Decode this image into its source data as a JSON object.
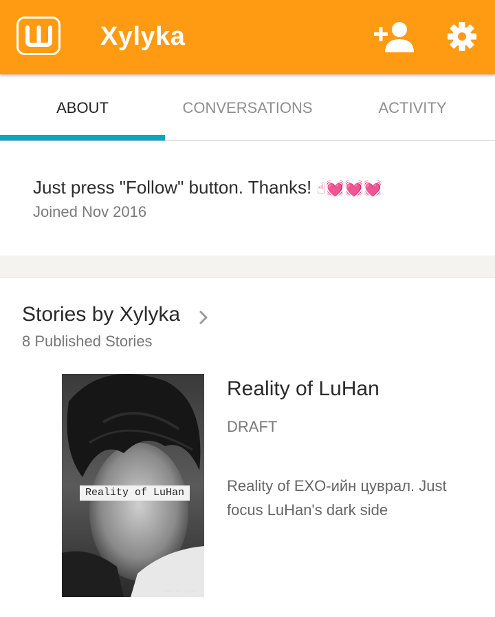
{
  "appbar": {
    "logo_letter": "W",
    "title": "Xylyka",
    "brand_color": "#ff9b13",
    "icons": [
      "add-user-icon",
      "gear-icon"
    ]
  },
  "tabs": [
    {
      "label": "ABOUT",
      "active": true
    },
    {
      "label": "CONVERSATIONS",
      "active": false
    },
    {
      "label": "ACTIVITY",
      "active": false
    }
  ],
  "tab_indicator_color": "#0aa6bd",
  "about": {
    "text": "Just press \"Follow\" button. Thanks!",
    "emoji": "☝💓💓💓",
    "joined": "Joined Nov 2016"
  },
  "stories": {
    "header": "Stories by Xylyka",
    "count_label": "8 Published Stories",
    "items": [
      {
        "title": "Reality of LuHan",
        "status": "DRAFT",
        "description": "Reality of EXO-ийн цуврал. Just focus LuHan's dark side",
        "cover_title": "Reality of LuHan",
        "cover_credit": "Story by: Xylyka"
      }
    ]
  }
}
